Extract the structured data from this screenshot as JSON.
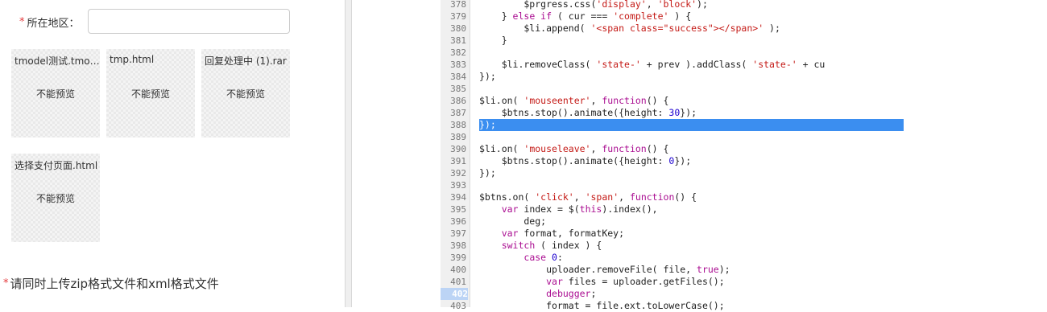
{
  "form": {
    "region_label": "所在地区：",
    "required_mark": "*",
    "region_value": "",
    "files": [
      {
        "name": "tmodel测试.tmodel",
        "preview": "不能预览"
      },
      {
        "name": "tmp.html",
        "preview": "不能预览"
      },
      {
        "name": "回复处理中 (1).rar",
        "preview": "不能预览"
      },
      {
        "name": "选择支付页面.html",
        "preview": "不能预览"
      }
    ],
    "note": "请同时上传zip格式文件和xml格式文件"
  },
  "editor": {
    "highlight_line": 388,
    "paused_line": 402,
    "lines": [
      {
        "n": "378",
        "segments": [
          [
            "",
            "        $prgress.css("
          ],
          [
            "s",
            "'display'"
          ],
          [
            "",
            ", "
          ],
          [
            "s",
            "'block'"
          ],
          [
            "",
            ");"
          ]
        ]
      },
      {
        "n": "379",
        "segments": [
          [
            "",
            "    } "
          ],
          [
            "k",
            "else if"
          ],
          [
            "",
            " ( cur === "
          ],
          [
            "s",
            "'complete'"
          ],
          [
            "",
            " ) {"
          ]
        ]
      },
      {
        "n": "380",
        "segments": [
          [
            "",
            "        $li.append( "
          ],
          [
            "s",
            "'<span class=\"success\"></span>'"
          ],
          [
            "",
            " );"
          ]
        ]
      },
      {
        "n": "381",
        "segments": [
          [
            "",
            "    }"
          ]
        ]
      },
      {
        "n": "382",
        "segments": [
          [
            "",
            ""
          ]
        ]
      },
      {
        "n": "383",
        "segments": [
          [
            "",
            "    $li.removeClass( "
          ],
          [
            "s",
            "'state-'"
          ],
          [
            "",
            " + prev ).addClass( "
          ],
          [
            "s",
            "'state-'"
          ],
          [
            "",
            " + cu"
          ]
        ]
      },
      {
        "n": "384",
        "segments": [
          [
            "",
            "});"
          ]
        ]
      },
      {
        "n": "385",
        "segments": [
          [
            "",
            ""
          ]
        ]
      },
      {
        "n": "386",
        "segments": [
          [
            "",
            "$li.on( "
          ],
          [
            "s",
            "'mouseenter'"
          ],
          [
            "",
            ", "
          ],
          [
            "k",
            "function"
          ],
          [
            "",
            "() {"
          ]
        ]
      },
      {
        "n": "387",
        "segments": [
          [
            "",
            "    $btns.stop().animate({height: "
          ],
          [
            "n",
            "30"
          ],
          [
            "",
            "});"
          ]
        ]
      },
      {
        "n": "388",
        "segments": [
          [
            "",
            "});"
          ]
        ]
      },
      {
        "n": "389",
        "segments": [
          [
            "",
            ""
          ]
        ]
      },
      {
        "n": "390",
        "segments": [
          [
            "",
            "$li.on( "
          ],
          [
            "s",
            "'mouseleave'"
          ],
          [
            "",
            ", "
          ],
          [
            "k",
            "function"
          ],
          [
            "",
            "() {"
          ]
        ]
      },
      {
        "n": "391",
        "segments": [
          [
            "",
            "    $btns.stop().animate({height: "
          ],
          [
            "n",
            "0"
          ],
          [
            "",
            "});"
          ]
        ]
      },
      {
        "n": "392",
        "segments": [
          [
            "",
            "});"
          ]
        ]
      },
      {
        "n": "393",
        "segments": [
          [
            "",
            ""
          ]
        ]
      },
      {
        "n": "394",
        "segments": [
          [
            "",
            "$btns.on( "
          ],
          [
            "s",
            "'click'"
          ],
          [
            "",
            ", "
          ],
          [
            "s",
            "'span'"
          ],
          [
            "",
            ", "
          ],
          [
            "k",
            "function"
          ],
          [
            "",
            "() {"
          ]
        ]
      },
      {
        "n": "395",
        "segments": [
          [
            "",
            "    "
          ],
          [
            "k",
            "var"
          ],
          [
            "",
            " index = $("
          ],
          [
            "k",
            "this"
          ],
          [
            "",
            ").index(),"
          ]
        ]
      },
      {
        "n": "396",
        "segments": [
          [
            "",
            "        deg;"
          ]
        ]
      },
      {
        "n": "397",
        "segments": [
          [
            "",
            "    "
          ],
          [
            "k",
            "var"
          ],
          [
            "",
            " format, formatKey;"
          ]
        ]
      },
      {
        "n": "398",
        "segments": [
          [
            "",
            "    "
          ],
          [
            "k",
            "switch"
          ],
          [
            "",
            " ( index ) {"
          ]
        ]
      },
      {
        "n": "399",
        "segments": [
          [
            "",
            "        "
          ],
          [
            "k",
            "case"
          ],
          [
            "",
            " "
          ],
          [
            "n",
            "0"
          ],
          [
            "",
            ":"
          ]
        ]
      },
      {
        "n": "400",
        "segments": [
          [
            "",
            "            uploader.removeFile( file, "
          ],
          [
            "k",
            "true"
          ],
          [
            "",
            ");"
          ]
        ]
      },
      {
        "n": "401",
        "segments": [
          [
            "",
            "            "
          ],
          [
            "k",
            "var"
          ],
          [
            "",
            " files = uploader.getFiles();"
          ]
        ]
      },
      {
        "n": "402",
        "segments": [
          [
            "",
            "            "
          ],
          [
            "k",
            "debugger"
          ],
          [
            "",
            ";"
          ]
        ]
      },
      {
        "n": "403",
        "segments": [
          [
            "",
            "            format = file.ext.toLowerCase();"
          ]
        ]
      }
    ]
  }
}
